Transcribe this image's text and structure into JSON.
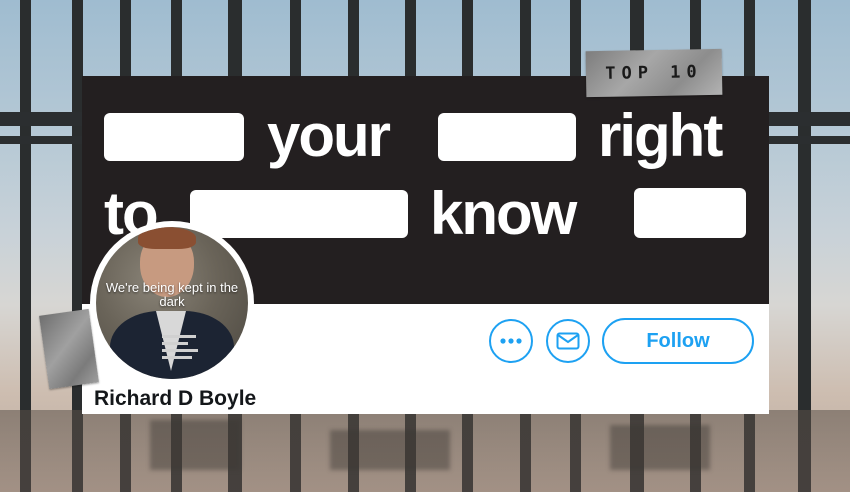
{
  "banner": {
    "tape_label": "TOP 10",
    "line1": [
      "your",
      "right"
    ],
    "line2": [
      "to",
      "know"
    ]
  },
  "avatar": {
    "caption": "We're being kept in the dark"
  },
  "profile": {
    "name": "Richard D Boyle"
  },
  "actions": {
    "more_icon": "more-horizontal-icon",
    "message_icon": "envelope-icon",
    "follow_label": "Follow"
  },
  "colors": {
    "accent": "#1da1f2",
    "banner_bg": "#231f20"
  }
}
